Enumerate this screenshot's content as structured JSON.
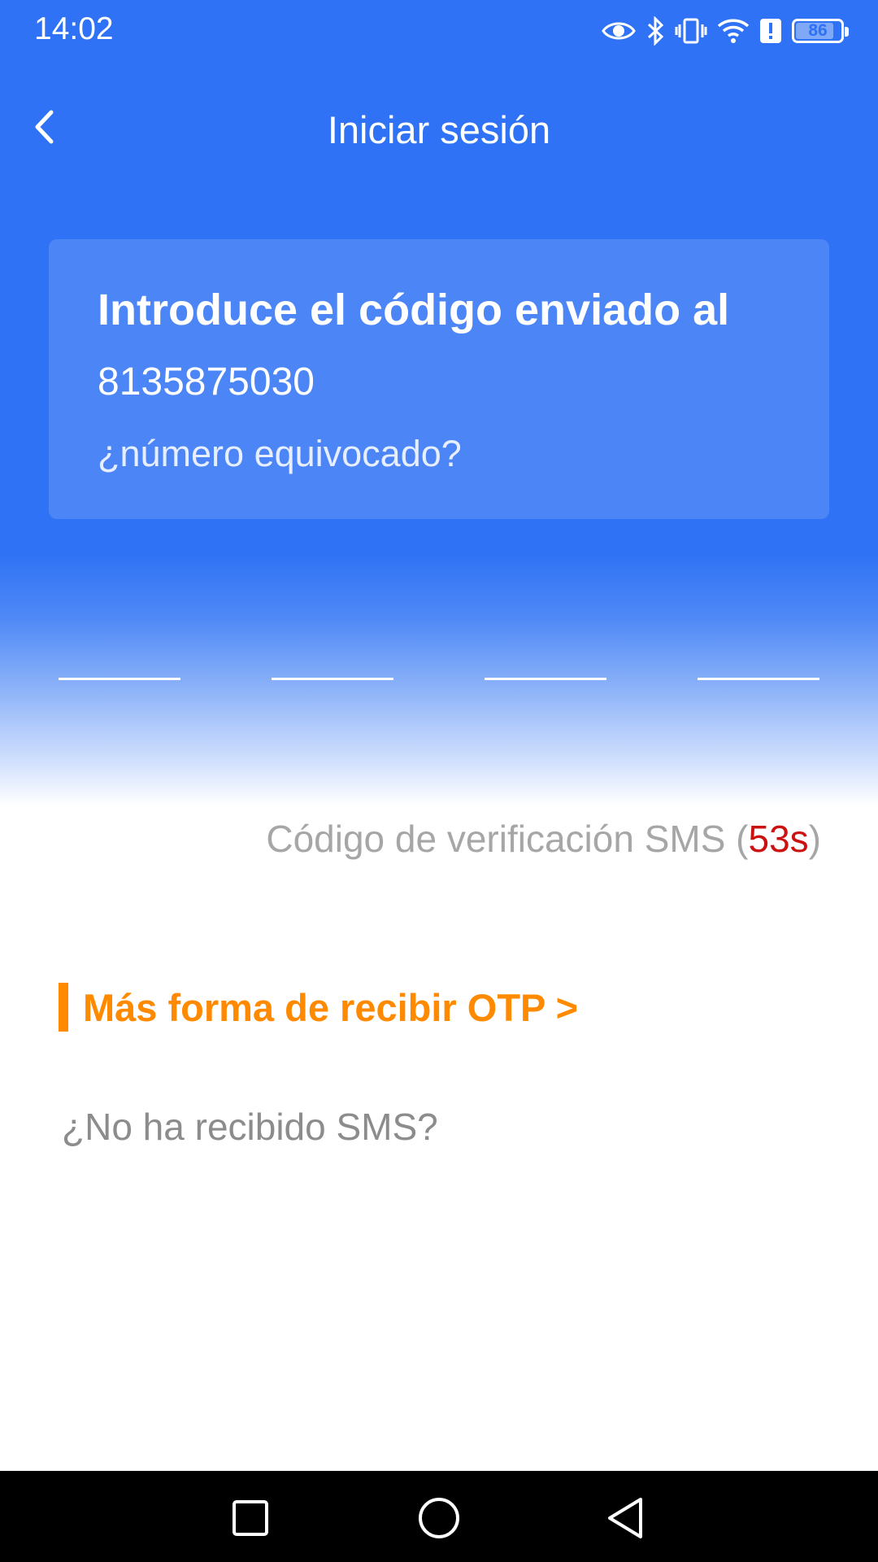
{
  "status_bar": {
    "time": "14:02",
    "battery": "86",
    "icons": [
      "eye-icon",
      "bluetooth-icon",
      "vibrate-icon",
      "wifi-icon",
      "alert-icon",
      "battery-icon"
    ]
  },
  "header": {
    "title": "Iniciar sesión",
    "back_icon": "chevron-left-icon"
  },
  "card": {
    "heading": "Introduce el código enviado al",
    "phone": "8135875030",
    "wrong_number": "¿número equivocado?"
  },
  "code_inputs": [
    "",
    "",
    "",
    ""
  ],
  "sms": {
    "prefix": "Código de verificación SMS (",
    "seconds": "53s",
    "suffix": ")"
  },
  "otp": {
    "label": "Más forma de recibir OTP >"
  },
  "no_sms": "¿No ha recibido SMS?",
  "nav": {
    "icons": [
      "recents-icon",
      "home-icon",
      "back-icon"
    ]
  },
  "colors": {
    "primary": "#2f72f5",
    "accent": "#ff8a00",
    "countdown": "#cc1111"
  }
}
